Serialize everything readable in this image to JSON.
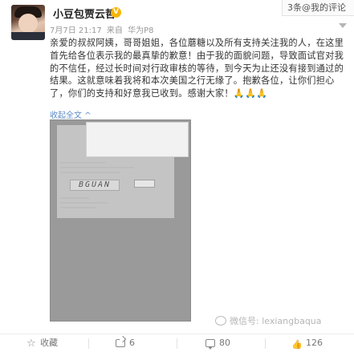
{
  "notification": {
    "text": "3条@我的评论"
  },
  "post": {
    "author": "小豆包贾云哲",
    "verified_badge": "V",
    "date": "7月7日 21:17",
    "source_prefix": "来自",
    "source": "华为P8",
    "content": "亲爱的叔叔阿姨，哥哥姐姐，各位蘑糖以及所有支持关注我的人，在这里首先给各位表示我的最真挚的歉意！由于我的面貌问题，导致面试官对我的不信任，经过长时间对行政审核的等待，到今天为止还没有接到通过的结果。这就意味着我将和本次美国之行无缘了。抱歉各位，让你们担心了，你们的支持和好意我已收到。感谢大家！",
    "emoji": "🙏🙏🙏",
    "collapse_label": "收起全文",
    "collapse_arrow": "^",
    "image": {
      "captcha_text": "BGUAN"
    }
  },
  "watermark": {
    "text": "微信号: lexiangbaqua"
  },
  "actions": {
    "favorite": {
      "label": "收藏",
      "icon": "star-icon"
    },
    "repost": {
      "count": "6",
      "icon": "share-icon"
    },
    "comment": {
      "count": "80",
      "icon": "comment-icon"
    },
    "like": {
      "count": "126",
      "icon": "thumbs-up-icon"
    }
  },
  "colors": {
    "link": "#5a8ac6",
    "badge": "#f7b500",
    "meta": "#999999"
  }
}
